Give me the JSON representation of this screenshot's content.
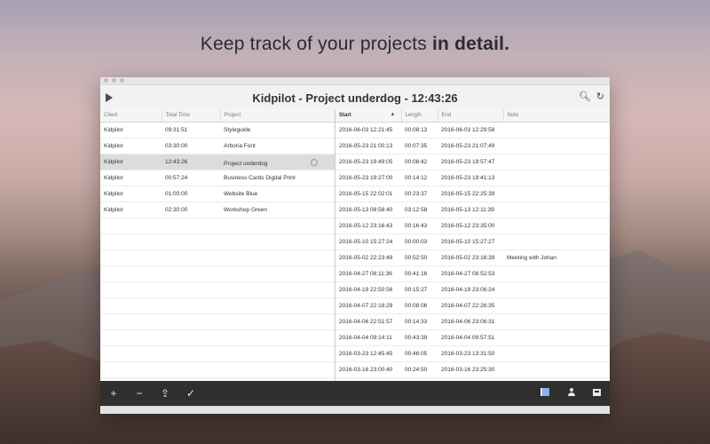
{
  "headline": {
    "normal": "Keep track of your projects ",
    "bold": "in detail."
  },
  "window": {
    "title": "Kidpilot - Project underdog - 12:43:26",
    "icons": [
      "play-icon",
      "search-icon",
      "refresh-icon"
    ]
  },
  "left_table": {
    "headers": [
      "Client",
      "Total Time",
      "Project"
    ],
    "rows": [
      [
        "Kidpilot",
        "09:31:51",
        "Styleguide"
      ],
      [
        "Kidpilot",
        "03:30:00",
        "Arboria Font"
      ],
      [
        "Kidpilot",
        "12:43:26",
        "Project underdog"
      ],
      [
        "Kidpilot",
        "00:57:24",
        "Business Cards Digital Print"
      ],
      [
        "Kidpilot",
        "01:00:00",
        "Website Blue"
      ],
      [
        "Kidpilot",
        "02:30:00",
        "Workshop Green"
      ]
    ],
    "selected_row": 2
  },
  "right_table": {
    "headers": [
      "Start",
      "Length",
      "End",
      "Note"
    ],
    "sorted_column": "Start",
    "sort_direction": "ascending",
    "rows": [
      [
        "2016-06-03 12:21:45",
        "00:08:13",
        "2016-06-03 12:29:58",
        ""
      ],
      [
        "2016-05-23 21:00:13",
        "00:07:35",
        "2016-05-23 21:07:49",
        ""
      ],
      [
        "2016-05-23 19:49:05",
        "00:08:42",
        "2016-05-23 19:57:47",
        ""
      ],
      [
        "2016-05-23 19:27:00",
        "00:14:12",
        "2016-05-23 19:41:13",
        ""
      ],
      [
        "2016-05-15 22:02:01",
        "00:23:37",
        "2016-05-15 22:25:39",
        ""
      ],
      [
        "2016-05-13 08:58:40",
        "03:12:58",
        "2016-05-13 12:11:39",
        ""
      ],
      [
        "2016-05-12 23:16:43",
        "00:16:43",
        "2016-05-12 23:35:00",
        ""
      ],
      [
        "2016-05-10 15:27:24",
        "00:00:03",
        "2016-05-10 15:27:27",
        ""
      ],
      [
        "2016-05-02 22:23:49",
        "00:52:50",
        "2016-05-02 23:16:39",
        "Meeting with Johan"
      ],
      [
        "2016-04-27 08:11:36",
        "00:41:16",
        "2016-04-27 08:52:53",
        ""
      ],
      [
        "2016-04-19 22:50:56",
        "00:15:27",
        "2016-04-19 23:06:24",
        ""
      ],
      [
        "2016-04-07 22:18:29",
        "00:08:06",
        "2016-04-07 22:26:35",
        ""
      ],
      [
        "2016-04-06 22:51:57",
        "00:14:33",
        "2016-04-06 23:06:31",
        ""
      ],
      [
        "2016-04-04 09:14:11",
        "00:43:39",
        "2016-04-04 09:57:51",
        ""
      ],
      [
        "2016-03-23 12:45:45",
        "00:46:05",
        "2016-03-23 13:31:50",
        ""
      ],
      [
        "2016-03-16 23:00:40",
        "00:24:50",
        "2016-03-16 23:25:30",
        ""
      ]
    ]
  },
  "bottom_bar": {
    "left_buttons": [
      {
        "name": "add-icon",
        "glyph": "+"
      },
      {
        "name": "remove-icon",
        "glyph": "−"
      },
      {
        "name": "share-icon",
        "glyph": "⇪"
      },
      {
        "name": "checkmark-icon",
        "glyph": "✓"
      }
    ],
    "right_buttons": [
      "book-icon",
      "user-icon",
      "tray-icon"
    ]
  },
  "colors": {
    "selection": "#dcdcdc",
    "bottom_bar": "#2f2f2f",
    "accent": "#8fb0e6"
  }
}
